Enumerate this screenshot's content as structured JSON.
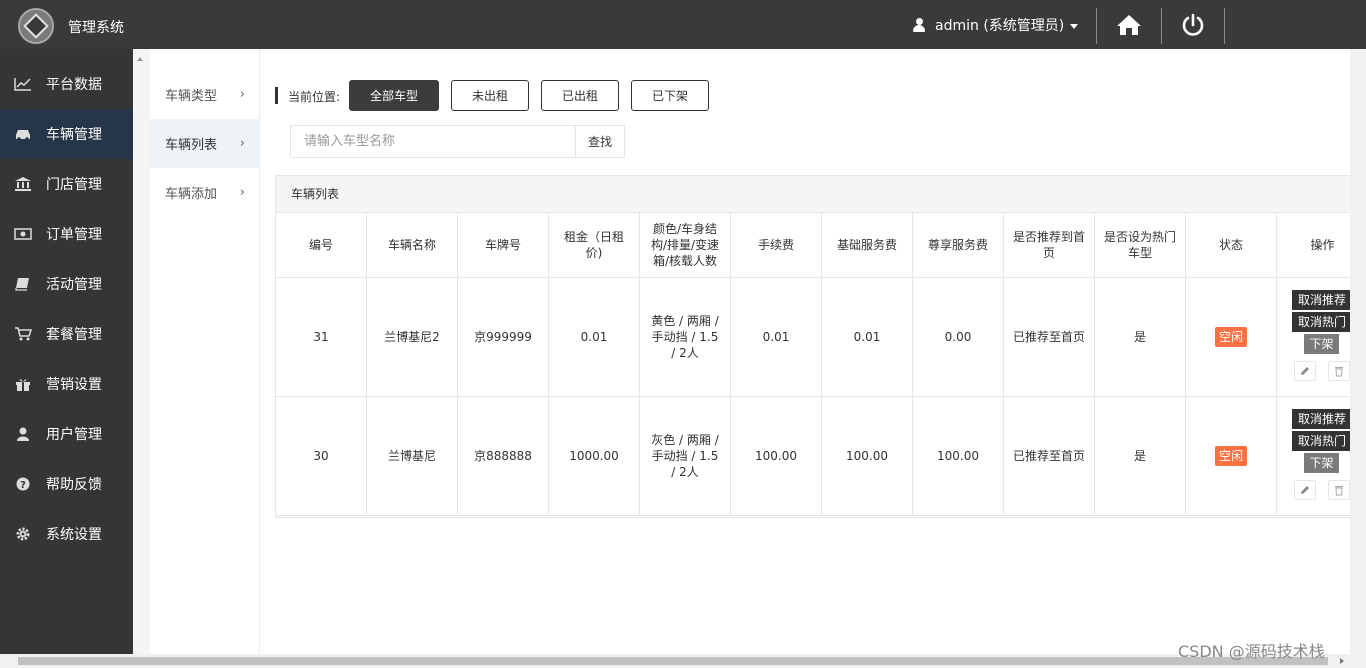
{
  "header": {
    "app_title": "管理系统",
    "user_label": "admin (系统管理员)"
  },
  "sidebar": {
    "items": [
      {
        "label": "平台数据",
        "icon": "line-chart-icon"
      },
      {
        "label": "车辆管理",
        "icon": "car-icon",
        "active": true
      },
      {
        "label": "门店管理",
        "icon": "bank-icon"
      },
      {
        "label": "订单管理",
        "icon": "money-icon"
      },
      {
        "label": "活动管理",
        "icon": "book-icon"
      },
      {
        "label": "套餐管理",
        "icon": "cart-icon"
      },
      {
        "label": "营销设置",
        "icon": "gift-icon"
      },
      {
        "label": "用户管理",
        "icon": "user-icon"
      },
      {
        "label": "帮助反馈",
        "icon": "question-icon"
      },
      {
        "label": "系统设置",
        "icon": "gear-icon"
      }
    ]
  },
  "submenu": {
    "items": [
      {
        "label": "车辆类型",
        "chevron": "›"
      },
      {
        "label": "车辆列表",
        "chevron": "›",
        "active": true
      },
      {
        "label": "车辆添加",
        "chevron": "›"
      }
    ]
  },
  "breadcrumb": {
    "label": "当前位置:"
  },
  "filters": [
    {
      "label": "全部车型",
      "active": true
    },
    {
      "label": "未出租"
    },
    {
      "label": "已出租"
    },
    {
      "label": "已下架"
    }
  ],
  "search": {
    "placeholder": "请输入车型名称",
    "button_label": "查找"
  },
  "table": {
    "title": "车辆列表",
    "columns": [
      "编号",
      "车辆名称",
      "车牌号",
      "租金（日租价)",
      "颜色/车身结构/排量/变速箱/核载人数",
      "手续费",
      "基础服务费",
      "尊享服务费",
      "是否推荐到首页",
      "是否设为热门车型",
      "状态",
      "操作"
    ],
    "rows": [
      {
        "id": "31",
        "name": "兰博基尼2",
        "plate": "京999999",
        "rent": "0.01",
        "spec": "黄色 / 两厢 / 手动挡 / 1.5 / 2人",
        "fee": "0.01",
        "basic": "0.01",
        "vip": "0.00",
        "recommended": "已推荐至首页",
        "hot": "是",
        "status": "空闲"
      },
      {
        "id": "30",
        "name": "兰博基尼",
        "plate": "京888888",
        "rent": "1000.00",
        "spec": "灰色 / 两厢 / 手动挡 / 1.5 / 2人",
        "fee": "100.00",
        "basic": "100.00",
        "vip": "100.00",
        "recommended": "已推荐至首页",
        "hot": "是",
        "status": "空闲"
      }
    ],
    "actions": {
      "cancel_recommend": "取消推荐",
      "cancel_hot": "取消热门",
      "offline": "下架"
    }
  },
  "colors": {
    "topbar": "#3a3a3a",
    "sidebar": "#353535",
    "sidebar_active": "#273548",
    "status_badge": "#ff7043"
  },
  "watermark": "CSDN @源码技术栈"
}
